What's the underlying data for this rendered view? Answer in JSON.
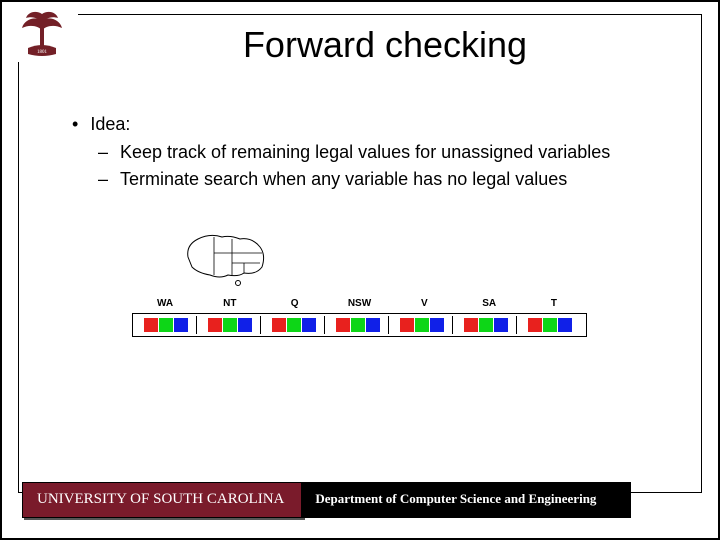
{
  "title": "Forward checking",
  "bullets": {
    "idea": "Idea:",
    "sub1": "Keep track of remaining legal values for unassigned variables",
    "sub2": "Terminate search when any variable has no legal values"
  },
  "regions": [
    "WA",
    "NT",
    "Q",
    "NSW",
    "V",
    "SA",
    "T"
  ],
  "domains": {
    "WA": [
      "r",
      "g",
      "b"
    ],
    "NT": [
      "r",
      "g",
      "b"
    ],
    "Q": [
      "r",
      "g",
      "b"
    ],
    "NSW": [
      "r",
      "g",
      "b"
    ],
    "V": [
      "r",
      "g",
      "b"
    ],
    "SA": [
      "r",
      "g",
      "b"
    ],
    "T": [
      "r",
      "g",
      "b"
    ]
  },
  "footer": {
    "university": "UNIVERSITY OF SOUTH CAROLINA",
    "department": "Department of Computer Science and Engineering"
  }
}
